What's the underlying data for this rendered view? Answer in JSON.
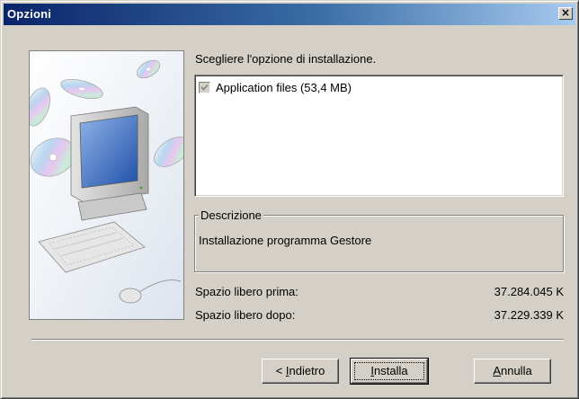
{
  "window": {
    "title": "Opzioni"
  },
  "title_bar": {
    "close_glyph": "×"
  },
  "illustration": {
    "icon": "computer-with-cds-illustration"
  },
  "main": {
    "prompt": "Scegliere l'opzione di installazione.",
    "options": [
      {
        "label": "Application files (53,4 MB)",
        "checked": true
      }
    ],
    "description": {
      "legend": "Descrizione",
      "text": "Installazione  programma Gestore"
    }
  },
  "space": {
    "before_label": "Spazio libero prima:",
    "before_value": "37.284.045 K",
    "after_label": "Spazio libero dopo:",
    "after_value": "37.229.339 K"
  },
  "buttons": {
    "back": {
      "before": "< ",
      "mnemonic": "I",
      "after": "ndietro"
    },
    "install": {
      "before": "",
      "mnemonic": "I",
      "after": "nstalla"
    },
    "cancel": {
      "before": "",
      "mnemonic": "A",
      "after": "nnulla"
    }
  },
  "colors": {
    "title_gradient_start": "#0a246a",
    "title_gradient_end": "#a6caf0",
    "dialog_face": "#d4d0c8"
  }
}
